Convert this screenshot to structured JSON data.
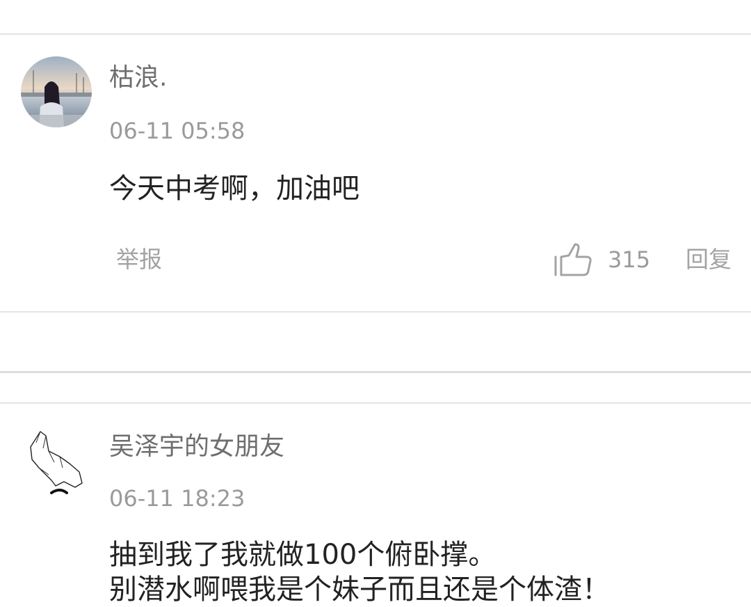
{
  "comments": [
    {
      "username": "枯浪.",
      "timestamp": "06-11 05:58",
      "content_lines": [
        "今天中考啊，加油吧"
      ],
      "report_label": "举报",
      "like_count": "315",
      "reply_label": "回复"
    },
    {
      "username": "吴泽宇的女朋友",
      "timestamp": "06-11 18:23",
      "content_lines": [
        "抽到我了我就做100个俯卧撑。",
        "别潜水啊喂我是个妹子而且还是个体渣！"
      ]
    }
  ]
}
